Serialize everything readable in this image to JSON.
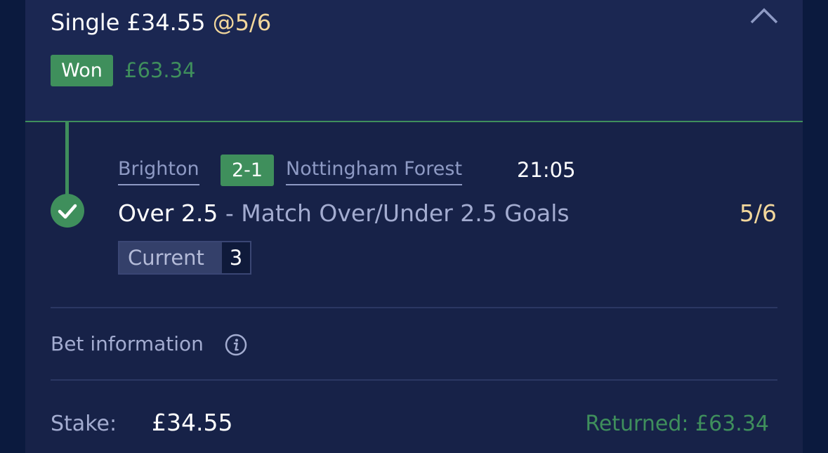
{
  "bet": {
    "type_stake": "Single £34.55",
    "odds": "@5/6",
    "status": "Won",
    "returns": "£63.34"
  },
  "event": {
    "home_team": "Brighton",
    "score": "2-1",
    "away_team": "Nottingham Forest",
    "time": "21:05"
  },
  "selection": {
    "name": "Over 2.5",
    "market": " - Match Over/Under 2.5 Goals",
    "odds": "5/6",
    "current_label": "Current",
    "current_value": "3"
  },
  "info": {
    "label": "Bet information"
  },
  "footer": {
    "stake_label": "Stake:",
    "stake_value": "£34.55",
    "returned": "Returned: £63.34"
  },
  "icons": {
    "collapse": "chevron-up-icon",
    "settled": "check-circle-icon",
    "info": "info-icon"
  },
  "colors": {
    "background": "#0b1a3e",
    "card": "#172248",
    "header": "#1b2752",
    "accent_green": "#3f8f5c",
    "odds_gold": "#f2d79c",
    "muted_text": "#a3acd0"
  }
}
